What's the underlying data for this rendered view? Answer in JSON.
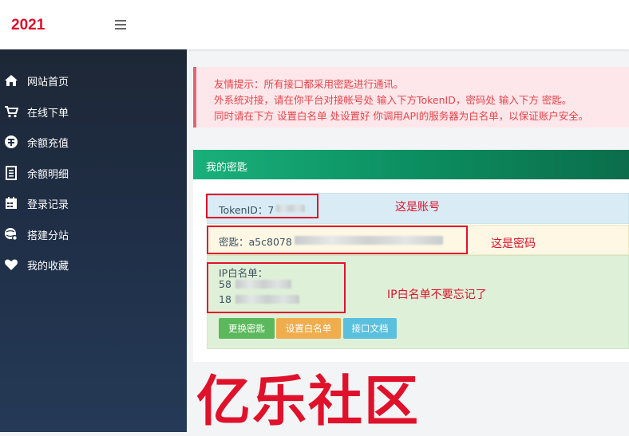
{
  "header": {
    "brand": "2021",
    "menu_icon": "hamburger-icon"
  },
  "sidebar": {
    "items": [
      {
        "label": "网站首页",
        "icon": "home-icon"
      },
      {
        "label": "在线下单",
        "icon": "cart-icon"
      },
      {
        "label": "余额充值",
        "icon": "recharge-icon"
      },
      {
        "label": "余额明细",
        "icon": "list-icon"
      },
      {
        "label": "登录记录",
        "icon": "calendar-icon"
      },
      {
        "label": "搭建分站",
        "icon": "globe-gear-icon"
      },
      {
        "label": "我的收藏",
        "icon": "heart-icon"
      }
    ]
  },
  "notice": {
    "line1": "友情提示：所有接口都采用密匙进行通讯。",
    "line2": "外系统对接，请在你平台对接帐号处 输入下方TokenID，密码处 输入下方 密匙。",
    "line3": "同时请在下方 设置白名单 处设置好 你调用API的服务器为白名单，以保证账户安全。"
  },
  "key_card": {
    "title": "我的密匙",
    "token_label": "TokenID：7",
    "secret_label": "密匙：a5c8078",
    "whitelist_label": "IP白名单：",
    "ip1_prefix": "58",
    "ip2_prefix": "18",
    "buttons": {
      "change_key": "更换密匙",
      "set_whitelist": "设置白名单",
      "api_docs": "接口文档"
    }
  },
  "annotations": {
    "account": "这是账号",
    "password": "这是密码",
    "whitelist": "IP白名单不要忘记了",
    "watermark": "亿乐社区"
  },
  "colors": {
    "brand_red": "#e0112b",
    "sidebar_bg": "#1d2736",
    "card_header_green": "#19b07c",
    "btn_green": "#5cb85c",
    "btn_orange": "#f0ad4e",
    "btn_blue": "#5bc0de"
  }
}
